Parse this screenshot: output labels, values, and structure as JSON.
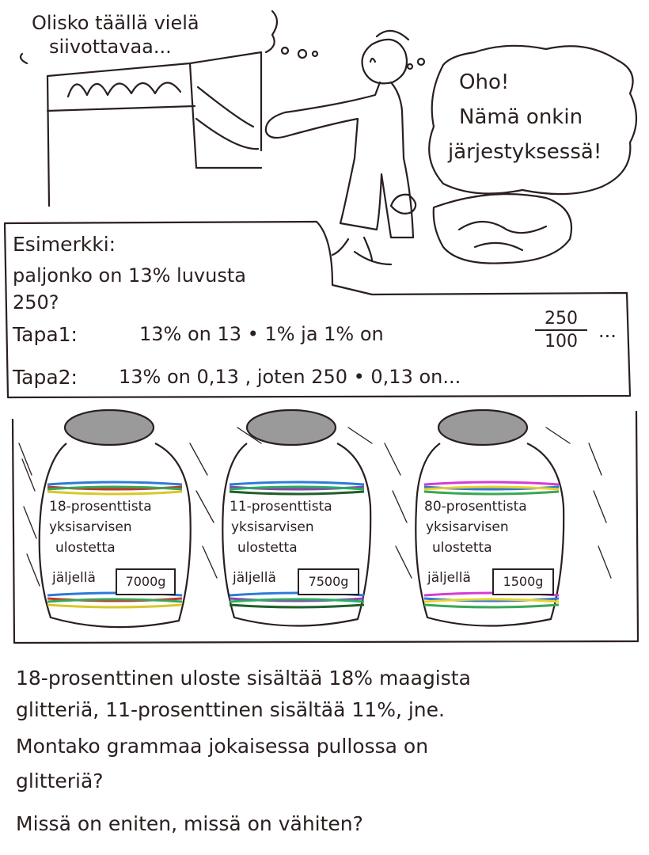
{
  "top_panel": {
    "thought_left": [
      "Olisko täällä vielä",
      "siivottavaa..."
    ],
    "thought_right": [
      "Oho!",
      "Nämä onkin",
      "järjestyksessä!"
    ]
  },
  "example": {
    "title": "Esimerkki:",
    "question_line1": "paljonko on 13% luvusta",
    "question_line2": "250?",
    "way1_label": "Tapa1:",
    "way1_text": "13% on 13 • 1% ja 1% on",
    "way1_frac_num": "250",
    "way1_frac_den": "100",
    "way1_tail": "...",
    "way2_label": "Tapa2:",
    "way2_text": "13% on 0,13 , joten 250 • 0,13 on..."
  },
  "jars": [
    {
      "line1": "18-prosenttista",
      "line2": "yksisarvisen",
      "line3": "ulostetta",
      "left_label": "jäljellä",
      "amount": "7000g",
      "stripe_colors": [
        "#2d7bd6",
        "#c0392b",
        "#3aa655",
        "#d7c82a"
      ]
    },
    {
      "line1": "11-prosenttista",
      "line2": "yksisarvisen",
      "line3": "ulostetta",
      "left_label": "jäljellä",
      "amount": "7500g",
      "stripe_colors": [
        "#2d7bd6",
        "#8e44ad",
        "#27ae60",
        "#1f5f2a"
      ]
    },
    {
      "line1": "80-prosenttista",
      "line2": "yksisarvisen",
      "line3": "ulostetta",
      "left_label": "jäljellä",
      "amount": "1500g",
      "stripe_colors": [
        "#d63ad6",
        "#2d7bd6",
        "#e6d22a",
        "#3aa655"
      ]
    }
  ],
  "bottom_text": {
    "line1": "18-prosenttinen uloste sisältää 18% maagista",
    "line2": "glitteriä, 11-prosenttinen sisältää 11%, jne.",
    "line3": "Montako grammaa jokaisessa pullossa on",
    "line4": "glitteriä?",
    "line5": "Missä on eniten, missä on vähiten?"
  }
}
